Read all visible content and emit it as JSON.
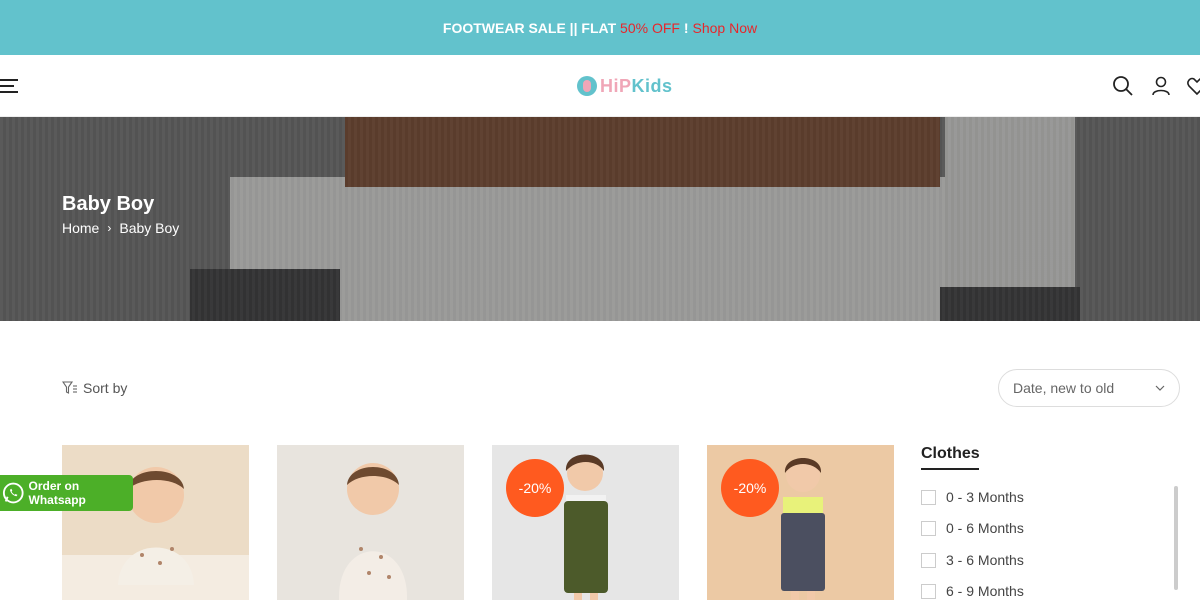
{
  "announcement": {
    "prefix": "FOOTWEAR SALE || FLAT ",
    "highlight": "50% OFF",
    "suffix": " !",
    "link": "Shop Now"
  },
  "header": {
    "logo_text_a": "HiP",
    "logo_text_b": "Kids"
  },
  "hero": {
    "title": "Baby Boy",
    "breadcrumb": [
      "Home",
      "Baby Boy"
    ]
  },
  "toolbar": {
    "sort_label": "Sort by",
    "sort_value": "Date, new to old"
  },
  "products": [
    {
      "badge": ""
    },
    {
      "badge": ""
    },
    {
      "badge": "-20%"
    },
    {
      "badge": "-20%"
    }
  ],
  "whatsapp": {
    "label": "Order on Whatsapp"
  },
  "filter": {
    "title": "Clothes",
    "options": [
      "0 - 3 Months",
      "0 - 6 Months",
      "3 - 6 Months",
      "6 - 9 Months"
    ]
  },
  "colors": {
    "announcement_bg": "#62c2cc",
    "sale_red": "#e8262b",
    "badge_orange": "#ff5a1f",
    "whatsapp_green": "#4caf28"
  }
}
